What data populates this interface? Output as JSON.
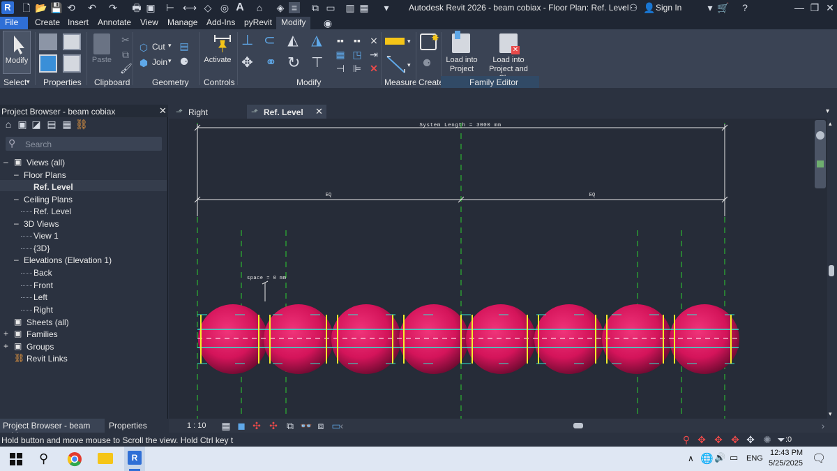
{
  "titlebar": {
    "logo": "R",
    "title": "Autodesk Revit 2026 - beam cobiax - Floor Plan: Ref. Level",
    "sign_in": "Sign In"
  },
  "menu": {
    "tabs": [
      "File",
      "Create",
      "Insert",
      "Annotate",
      "View",
      "Manage",
      "Add-Ins",
      "pyRevit",
      "Modify"
    ],
    "active_tab": "Modify"
  },
  "ribbon": {
    "modify_label": "Modify",
    "paste_label": "Paste",
    "cut_label": "Cut",
    "join_label": "Join",
    "activate_label": "Activate",
    "load_into_project": "Load into\nProject",
    "load_into_project_close": "Load into\nProject and Close",
    "panels": {
      "select": "Select",
      "properties": "Properties",
      "clipboard": "Clipboard",
      "geometry": "Geometry",
      "controls": "Controls",
      "modify": "Modify",
      "measure": "Measure",
      "create": "Create",
      "family_editor": "Family Editor"
    }
  },
  "project_browser": {
    "title": "Project Browser - beam cobiax",
    "search_placeholder": "Search",
    "items": [
      {
        "label": "Views (all)",
        "level": 0
      },
      {
        "label": "Floor Plans",
        "level": 1
      },
      {
        "label": "Ref. Level",
        "level": 2,
        "selected": true
      },
      {
        "label": "Ceiling Plans",
        "level": 1
      },
      {
        "label": "Ref. Level",
        "level": 2
      },
      {
        "label": "3D Views",
        "level": 1
      },
      {
        "label": "View 1",
        "level": 2
      },
      {
        "label": "{3D}",
        "level": 2
      },
      {
        "label": "Elevations (Elevation 1)",
        "level": 1
      },
      {
        "label": "Back",
        "level": 2
      },
      {
        "label": "Front",
        "level": 2
      },
      {
        "label": "Left",
        "level": 2
      },
      {
        "label": "Right",
        "level": 2
      },
      {
        "label": "Sheets (all)",
        "level": 0
      },
      {
        "label": "Families",
        "level": 0
      },
      {
        "label": "Groups",
        "level": 0
      },
      {
        "label": "Revit Links",
        "level": 0
      }
    ],
    "bottom_tabs": [
      "Project Browser - beam cobiax",
      "Properties"
    ]
  },
  "view_tabs": [
    {
      "label": "Right",
      "active": false
    },
    {
      "label": "Ref. Level",
      "active": true
    }
  ],
  "drawing": {
    "dimension_total": "System Length = 3000 mm",
    "eq_left": "EQ",
    "eq_right": "EQ",
    "space_label": "space = 0 mm",
    "sphere_count": 8,
    "colors": {
      "sphere": "#d4145a",
      "reference_line": "#2fd12f",
      "cage": "#2ee8d0",
      "rod": "#f5f02a"
    }
  },
  "view_control": {
    "scale": "1 : 10"
  },
  "status": {
    "message": "Hold button and move mouse to Scroll the view. Hold Ctrl key t",
    "filter_count": ":0"
  },
  "taskbar": {
    "language": "ENG",
    "time": "12:43 PM",
    "date": "5/25/2025",
    "revit_badge": "R"
  }
}
